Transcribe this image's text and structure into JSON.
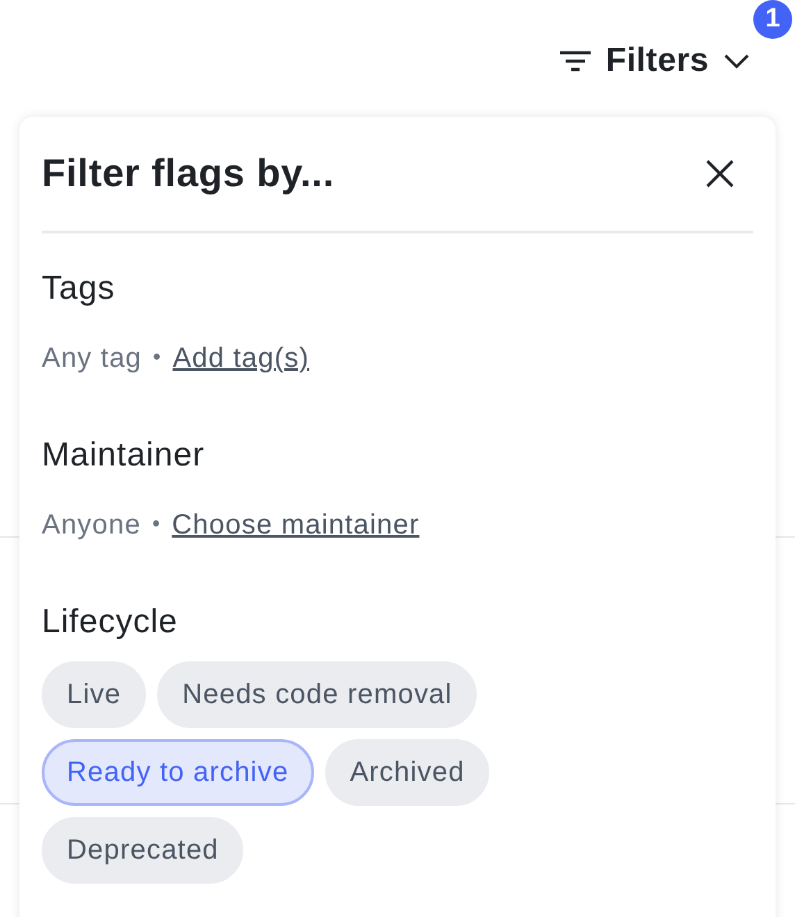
{
  "filter_button": {
    "label": "Filters",
    "badge": "1"
  },
  "panel": {
    "title": "Filter flags by...",
    "sections": [
      {
        "kind": "link",
        "label": "Tags",
        "current": "Any tag",
        "separator": "•",
        "link": "Add tag(s)"
      },
      {
        "kind": "link",
        "label": "Maintainer",
        "current": "Anyone",
        "separator": "•",
        "link": "Choose maintainer"
      },
      {
        "kind": "chips",
        "label": "Lifecycle",
        "chips": [
          {
            "label": "Live",
            "selected": false
          },
          {
            "label": "Needs code removal",
            "selected": false
          },
          {
            "label": "Ready to archive",
            "selected": true
          },
          {
            "label": "Archived",
            "selected": false
          },
          {
            "label": "Deprecated",
            "selected": false
          }
        ]
      }
    ]
  }
}
